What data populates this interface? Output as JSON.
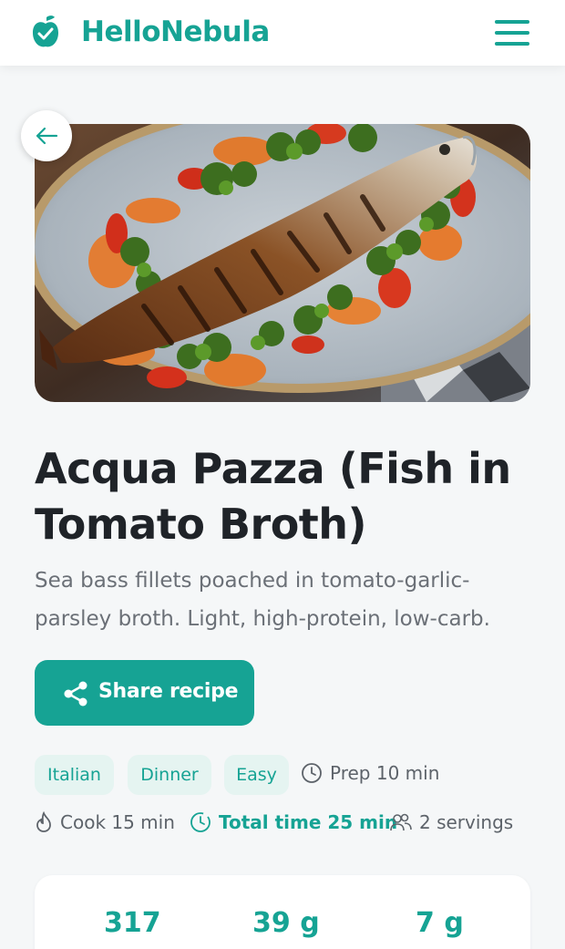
{
  "header": {
    "brand": "HelloNebula",
    "menu_icon": "hamburger-menu-icon",
    "logo_icon": "apple-check-icon"
  },
  "hero": {
    "image_description_icon": "grilled-fish-dish-image",
    "back_icon": "arrow-left-icon"
  },
  "recipe": {
    "title": "Acqua Pazza (Fish in Tomato Broth)",
    "description": "Sea bass fillets poached in tomato-garlic-parsley broth. Light, high-protein, low-carb."
  },
  "share": {
    "label": "Share recipe",
    "icon": "share-icon"
  },
  "tags": [
    "Italian",
    "Dinner",
    "Easy"
  ],
  "meta": {
    "prep": "Prep 10 min",
    "cook": "Cook 15 min",
    "total": "Total time 25 min",
    "servings": "2 servings"
  },
  "nutrition": {
    "calories": "317",
    "protein": "39 g",
    "fat": "7 g"
  },
  "colors": {
    "accent": "#16a394",
    "tag_bg": "#e5f4f1",
    "background": "#f5f7f8"
  }
}
